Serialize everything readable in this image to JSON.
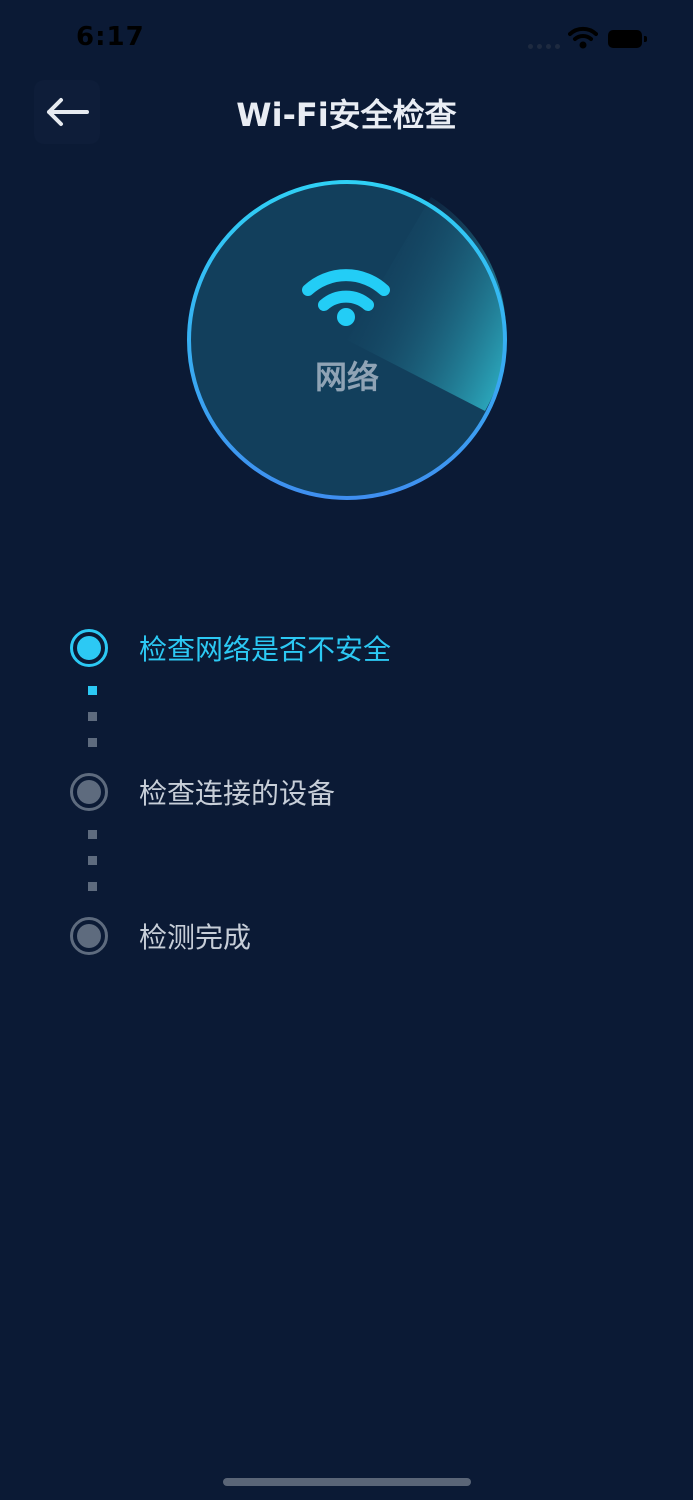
{
  "status_bar": {
    "time": "6:17"
  },
  "nav": {
    "title": "Wi-Fi安全检查"
  },
  "scan": {
    "label": "网络"
  },
  "steps": [
    {
      "label": "检查网络是否不安全",
      "state": "active"
    },
    {
      "label": "检查连接的设备",
      "state": "pending"
    },
    {
      "label": "检测完成",
      "state": "pending"
    }
  ],
  "colors": {
    "background": "#0b1a35",
    "accent": "#2cc9f4",
    "pending": "#5e6b7e"
  }
}
